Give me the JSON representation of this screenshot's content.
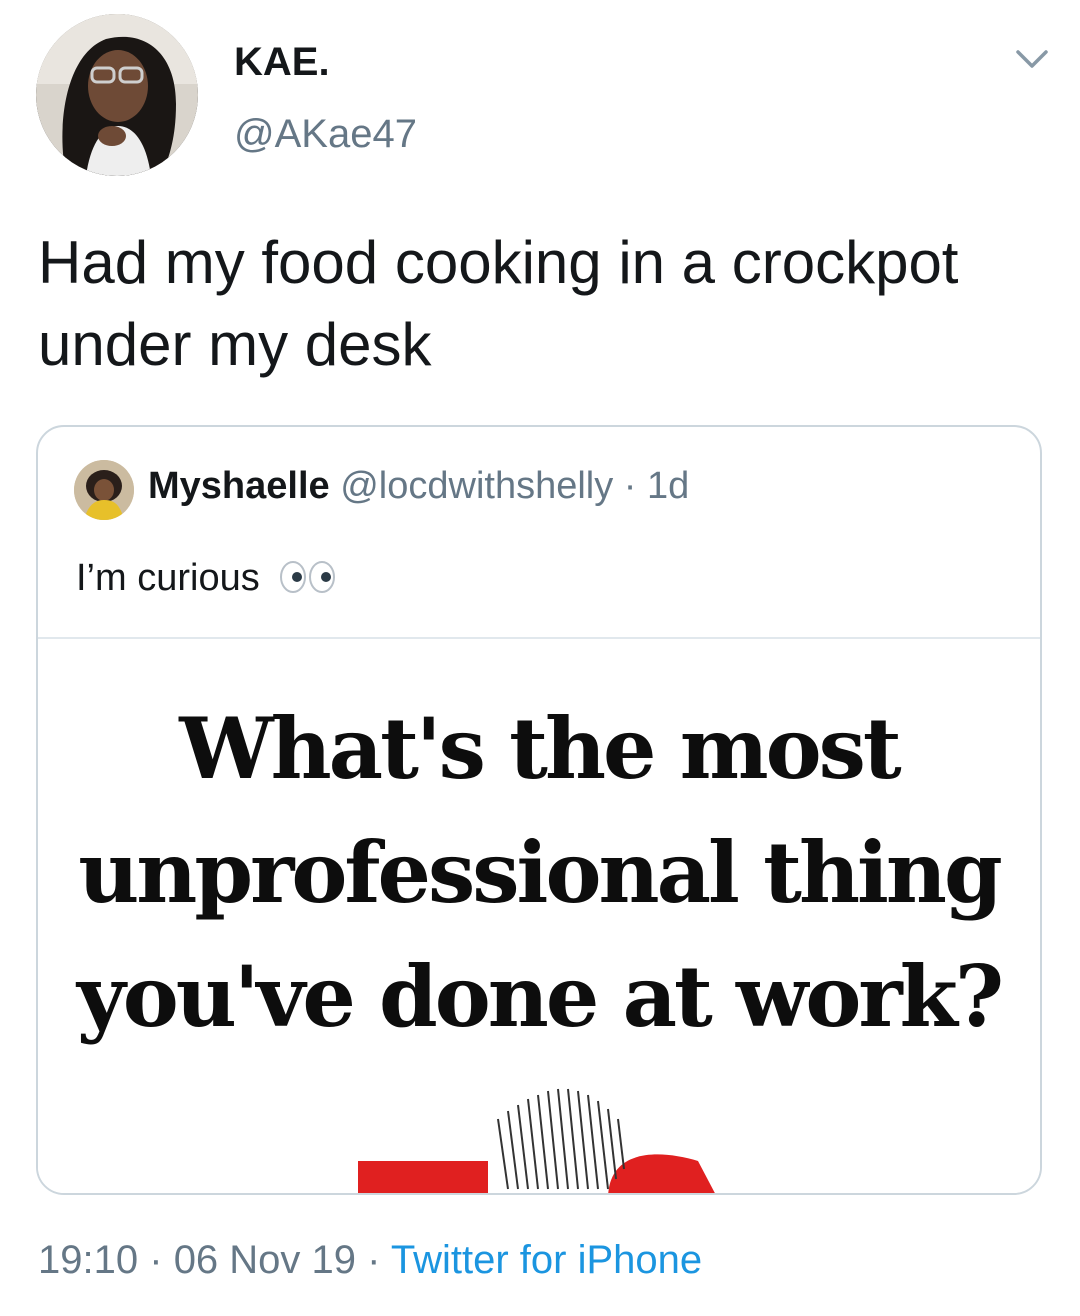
{
  "author": {
    "display_name": "KAE.",
    "handle": "@AKae47"
  },
  "tweet": {
    "text": "Had my food cooking in a crockpot under my desk"
  },
  "quoted_tweet": {
    "display_name": "Myshaelle",
    "handle": "@locdwithshelly",
    "separator": "·",
    "time": "1d",
    "text": "I’m curious",
    "image_caption": "What's the most unprofessional thing you've done at work?"
  },
  "meta": {
    "time": "19:10",
    "separator_1": "·",
    "date": "06 Nov 19",
    "separator_2": "·",
    "source": "Twitter for iPhone"
  },
  "icons": {
    "caret": "chevron-down-icon",
    "eyes_emoji": "eyes-emoji-icon"
  },
  "colors": {
    "text": "#14171a",
    "secondary": "#657786",
    "link": "#1b95e0",
    "border": "#ccd6dd"
  }
}
